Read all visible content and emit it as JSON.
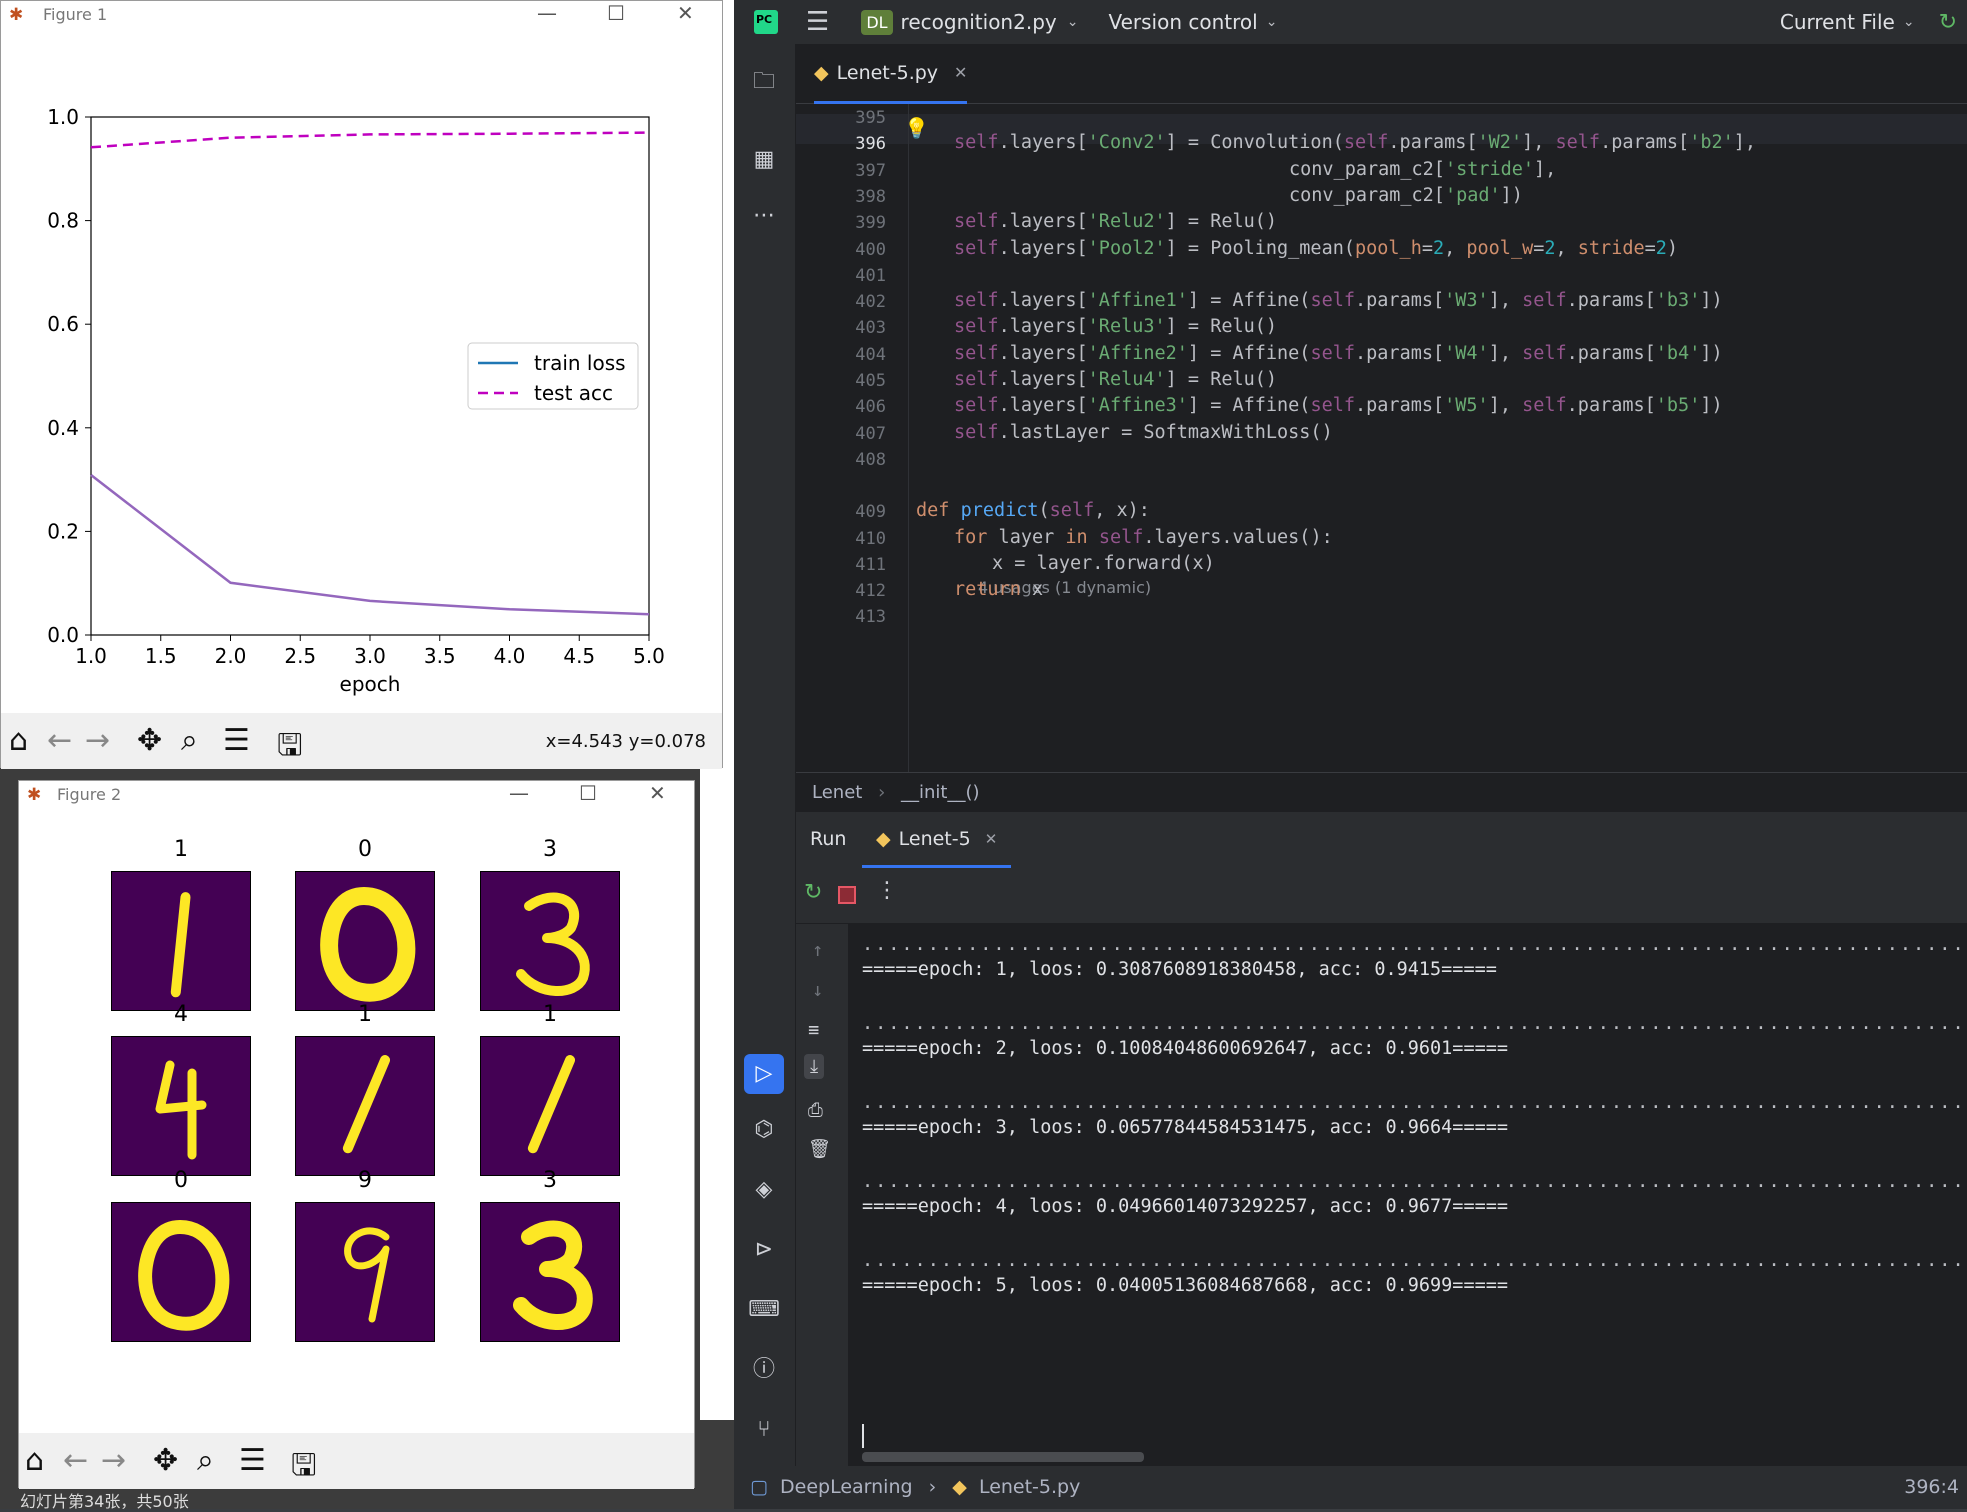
{
  "ide": {
    "project_badge": "DL",
    "project_name": "recognition2.py",
    "vcs": "Version control",
    "run_config": "Current File",
    "tab": "Lenet-5.py",
    "breadcrumb": [
      "Lenet",
      "__init__()"
    ],
    "run_label": "Run",
    "run_tab": "Lenet-5",
    "status_path": [
      "DeepLearning",
      "Lenet-5.py"
    ],
    "status_pos": "396:4",
    "usages": "4 usages (1 dynamic)"
  },
  "code_lines": [
    {
      "n": "395",
      "t": ""
    },
    {
      "n": "396",
      "t": "self.layers['Conv2'] = Convolution(self.params['W2'], self.params['b2'],"
    },
    {
      "n": "397",
      "t": "conv_param_c2['stride'],"
    },
    {
      "n": "398",
      "t": "conv_param_c2['pad'])"
    },
    {
      "n": "399",
      "t": "self.layers['Relu2'] = Relu()"
    },
    {
      "n": "400",
      "t": "self.layers['Pool2'] = Pooling_mean(pool_h=2, pool_w=2, stride=2)"
    },
    {
      "n": "401",
      "t": ""
    },
    {
      "n": "402",
      "t": "self.layers['Affine1'] = Affine(self.params['W3'], self.params['b3'])"
    },
    {
      "n": "403",
      "t": "self.layers['Relu3'] = Relu()"
    },
    {
      "n": "404",
      "t": "self.layers['Affine2'] = Affine(self.params['W4'], self.params['b4'])"
    },
    {
      "n": "405",
      "t": "self.layers['Relu4'] = Relu()"
    },
    {
      "n": "406",
      "t": "self.layers['Affine3'] = Affine(self.params['W5'], self.params['b5'])"
    },
    {
      "n": "407",
      "t": "self.lastLayer = SoftmaxWithLoss()"
    },
    {
      "n": "408",
      "t": ""
    },
    {
      "n": "409",
      "t": "def predict(self, x):"
    },
    {
      "n": "410",
      "t": "for layer in self.layers.values():"
    },
    {
      "n": "411",
      "t": "x = layer.forward(x)"
    },
    {
      "n": "412",
      "t": "return x"
    },
    {
      "n": "413",
      "t": ""
    }
  ],
  "console_lines": [
    "=====epoch: 1, loos: 0.3087608918380458, acc: 0.9415=====",
    "=====epoch: 2, loos: 0.10084048600692647, acc: 0.9601=====",
    "=====epoch: 3, loos: 0.06577844584531475, acc: 0.9664=====",
    "=====epoch: 4, loos: 0.04966014073292257, acc: 0.9677=====",
    "=====epoch: 5, loos: 0.04005136084687668, acc: 0.9699====="
  ],
  "figure1": {
    "title": "Figure 1",
    "coords": "x=4.543 y=0.078",
    "chart_data": {
      "type": "line",
      "xlabel": "epoch",
      "ylabel": "",
      "xlim": [
        1.0,
        5.0
      ],
      "ylim": [
        0.0,
        1.0
      ],
      "xticks": [
        "1.0",
        "1.5",
        "2.0",
        "2.5",
        "3.0",
        "3.5",
        "4.0",
        "4.5",
        "5.0"
      ],
      "yticks": [
        "0.0",
        "0.2",
        "0.4",
        "0.6",
        "0.8",
        "1.0"
      ],
      "x": [
        1,
        2,
        3,
        4,
        5
      ],
      "legend_position": "center right",
      "series": [
        {
          "name": "train loss",
          "values": [
            0.3088,
            0.1008,
            0.0658,
            0.0497,
            0.0401
          ],
          "color": "#9467bd",
          "legend_color": "#1f77b4",
          "style": "solid"
        },
        {
          "name": "test acc",
          "values": [
            0.9415,
            0.9601,
            0.9664,
            0.9677,
            0.9699
          ],
          "color": "#bf00bf",
          "style": "dashed"
        }
      ]
    }
  },
  "figure2": {
    "title": "Figure 2",
    "labels": [
      "1",
      "0",
      "3",
      "4",
      "1",
      "1",
      "0",
      "9",
      "3"
    ]
  },
  "colors": {
    "accent": "#3574f0",
    "mnist_bg": "#440154",
    "mnist_fg": "#fde725"
  },
  "bottom_text": "幻灯片第34张，共50张"
}
